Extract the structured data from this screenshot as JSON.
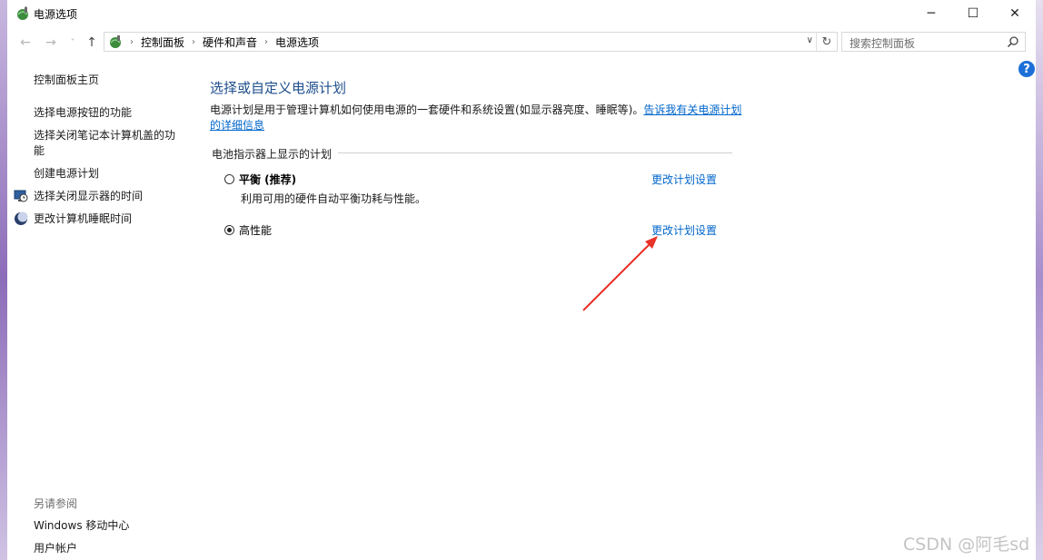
{
  "window": {
    "title": "电源选项",
    "minimize": "─",
    "maximize": "☐",
    "close": "✕"
  },
  "nav": {
    "back": "←",
    "forward": "→",
    "recent": "˅",
    "up": "↑",
    "breadcrumb": [
      "控制面板",
      "硬件和声音",
      "电源选项"
    ],
    "separator": "›",
    "dropdown": "∨",
    "refresh": "↻",
    "search_placeholder": "搜索控制面板"
  },
  "help": "?",
  "sidebar": {
    "items": [
      {
        "label": "控制面板主页",
        "icon": ""
      },
      {
        "label": "选择电源按钮的功能",
        "icon": ""
      },
      {
        "label": "选择关闭笔记本计算机盖的功\n能",
        "icon": ""
      },
      {
        "label": "创建电源计划",
        "icon": ""
      },
      {
        "label": "选择关闭显示器的时间",
        "icon": "monitor-clock-icon"
      },
      {
        "label": "更改计算机睡眠时间",
        "icon": "moon-icon"
      }
    ],
    "see_also_title": "另请参阅",
    "see_also": [
      "Windows 移动中心",
      "用户帐户"
    ]
  },
  "main": {
    "title": "选择或自定义电源计划",
    "description": "电源计划是用于管理计算机如何使用电源的一套硬件和系统设置(如显示器亮度、睡眠等)。",
    "description_link": "告诉我有关电源计划的详细信息",
    "section_title": "电池指示器上显示的计划",
    "plans": [
      {
        "name": "平衡 (推荐)",
        "description": "利用可用的硬件自动平衡功耗与性能。",
        "link": "更改计划设置",
        "selected": false
      },
      {
        "name": "高性能",
        "description": "",
        "link": "更改计划设置",
        "selected": true
      }
    ]
  },
  "watermark": "CSDN @阿毛sd",
  "colors": {
    "link": "#0066cc",
    "title": "#1e4e8c",
    "arrow": "#e8322a",
    "help": "#1d6fd8"
  }
}
